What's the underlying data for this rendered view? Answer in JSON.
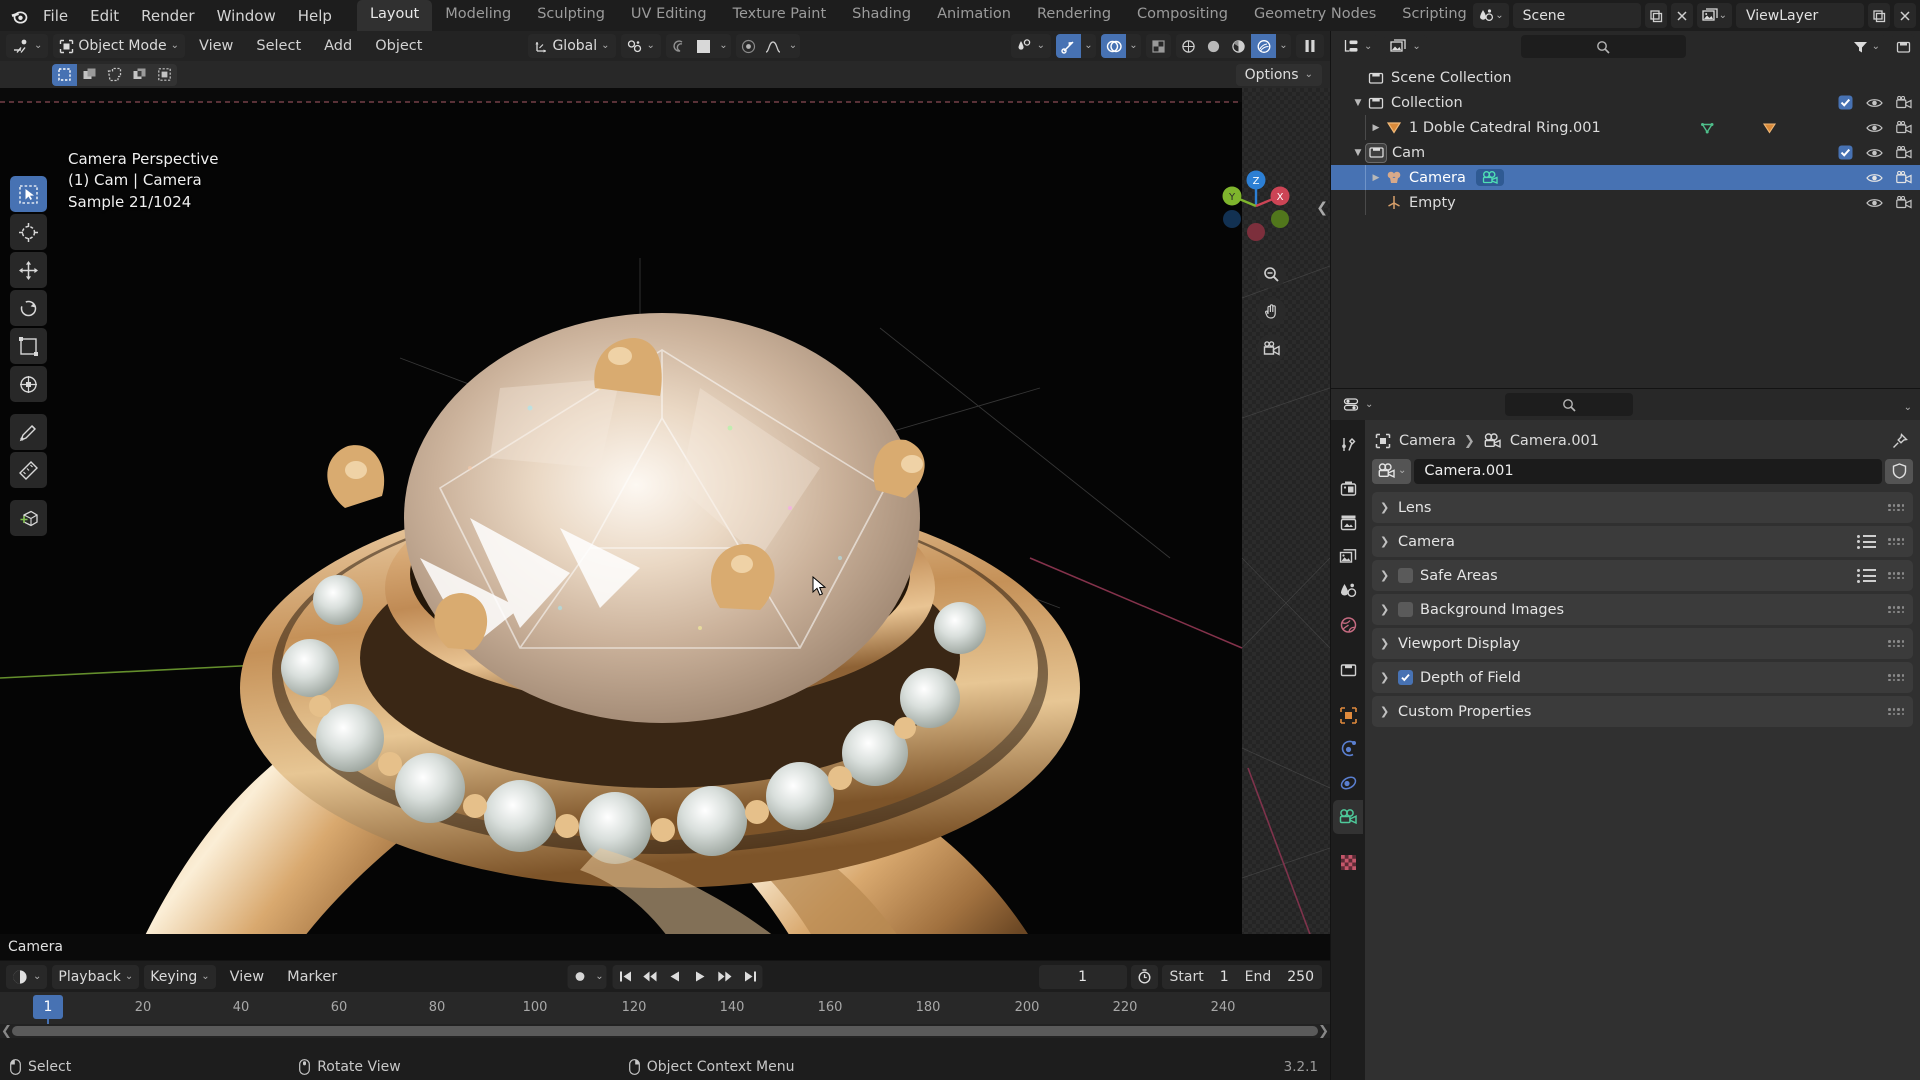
{
  "topbar": {
    "menus": [
      "File",
      "Edit",
      "Render",
      "Window",
      "Help"
    ],
    "workspace_tabs": [
      {
        "label": "Layout",
        "active": true
      },
      {
        "label": "Modeling",
        "active": false
      },
      {
        "label": "Sculpting",
        "active": false
      },
      {
        "label": "UV Editing",
        "active": false
      },
      {
        "label": "Texture Paint",
        "active": false
      },
      {
        "label": "Shading",
        "active": false
      },
      {
        "label": "Animation",
        "active": false
      },
      {
        "label": "Rendering",
        "active": false
      },
      {
        "label": "Compositing",
        "active": false
      },
      {
        "label": "Geometry Nodes",
        "active": false
      },
      {
        "label": "Scripting",
        "active": false
      }
    ],
    "add_workspace": "+",
    "scene_name": "Scene",
    "viewlayer_name": "ViewLayer"
  },
  "viewport_header": {
    "mode": "Object Mode",
    "menus": [
      "View",
      "Select",
      "Add",
      "Object"
    ],
    "transform_orientation": "Global"
  },
  "tool_settings": {
    "options_label": "Options"
  },
  "viewport": {
    "overlay_line1": "Camera Perspective",
    "overlay_line2": "(1) Cam | Camera",
    "overlay_line3": "Sample 21/1024",
    "footer_label": "Camera",
    "gizmo_axes": {
      "x": "X",
      "y": "Y",
      "z": "Z"
    }
  },
  "outliner": {
    "rows": [
      {
        "label": "Scene Collection",
        "icon": "collection-icon",
        "depth": 0,
        "expand": "none",
        "selected": false,
        "checkbox": false,
        "eye": false,
        "camera": false
      },
      {
        "label": "Collection",
        "icon": "collection-icon",
        "depth": 1,
        "expand": "down",
        "selected": false,
        "checkbox": true,
        "eye": true,
        "camera": true
      },
      {
        "label": "1 Doble Catedral Ring.001",
        "icon": "mesh-data-icon",
        "depth": 2,
        "expand": "right",
        "selected": false,
        "checkbox": false,
        "eye": true,
        "camera": true
      },
      {
        "label": "Cam",
        "icon": "collection-icon",
        "depth": 1,
        "expand": "down",
        "selected": false,
        "checkbox": true,
        "eye": true,
        "camera": true
      },
      {
        "label": "Camera",
        "icon": "camera-object-icon",
        "depth": 2,
        "expand": "right",
        "selected": true,
        "checkbox": false,
        "eye": true,
        "camera": true
      },
      {
        "label": "Empty",
        "icon": "empty-axes-icon",
        "depth": 2,
        "expand": "none",
        "selected": false,
        "checkbox": false,
        "eye": true,
        "camera": true
      }
    ]
  },
  "properties": {
    "breadcrumb_object": "Camera",
    "breadcrumb_data": "Camera.001",
    "datablock_name": "Camera.001",
    "panels": [
      {
        "label": "Lens",
        "checkbox": null,
        "list_icon": false
      },
      {
        "label": "Camera",
        "checkbox": null,
        "list_icon": true
      },
      {
        "label": "Safe Areas",
        "checkbox": false,
        "list_icon": true
      },
      {
        "label": "Background Images",
        "checkbox": false,
        "list_icon": false
      },
      {
        "label": "Viewport Display",
        "checkbox": null,
        "list_icon": false
      },
      {
        "label": "Depth of Field",
        "checkbox": true,
        "list_icon": false
      },
      {
        "label": "Custom Properties",
        "checkbox": null,
        "list_icon": false
      }
    ],
    "tabs": [
      {
        "name": "tool-tab",
        "color": "#d0d0d0",
        "on": false
      },
      {
        "name": "render-tab",
        "color": "#d0d0d0",
        "on": false
      },
      {
        "name": "output-tab",
        "color": "#d0d0d0",
        "on": false
      },
      {
        "name": "view-layer-tab",
        "color": "#d0d0d0",
        "on": false
      },
      {
        "name": "scene-tab",
        "color": "#d0d0d0",
        "on": false
      },
      {
        "name": "world-tab",
        "color": "#c46a80",
        "on": false
      },
      {
        "name": "collection-tab",
        "color": "#d0d0d0",
        "on": false
      },
      {
        "name": "object-tab",
        "color": "#e08a3c",
        "on": false
      },
      {
        "name": "modifiers-tab",
        "color": "#5a7fd0",
        "on": false
      },
      {
        "name": "physics-tab",
        "color": "#5a7fd0",
        "on": false
      },
      {
        "name": "object-data-tab",
        "color": "#4ec99a",
        "on": true
      },
      {
        "name": "texture-tab",
        "color": "#c4566a",
        "on": false
      }
    ]
  },
  "timeline": {
    "menus": [
      "Playback",
      "Keying",
      "View",
      "Marker"
    ],
    "current_frame": "1",
    "start_label": "Start",
    "start_value": "1",
    "end_label": "End",
    "end_value": "250",
    "ticks": [
      "20",
      "40",
      "60",
      "80",
      "100",
      "120",
      "140",
      "160",
      "180",
      "200",
      "220",
      "240"
    ],
    "tick_frames": [
      20,
      40,
      60,
      80,
      100,
      120,
      140,
      160,
      180,
      200,
      220,
      240
    ],
    "playhead_frame": "1"
  },
  "statusbar": {
    "items": [
      {
        "label": "Select",
        "icon": "mouse-left-icon"
      },
      {
        "label": "Rotate View",
        "icon": "mouse-middle-icon"
      },
      {
        "label": "Object Context Menu",
        "icon": "mouse-right-icon"
      }
    ],
    "version": "3.2.1"
  },
  "colors": {
    "accent_blue": "#4772b3",
    "panel_bg": "#303030",
    "header_bg": "#282828",
    "window_bg": "#1d1d1d",
    "axis_x": "#cc4455",
    "axis_y": "#7fb52d",
    "axis_z": "#2c7fd4"
  }
}
